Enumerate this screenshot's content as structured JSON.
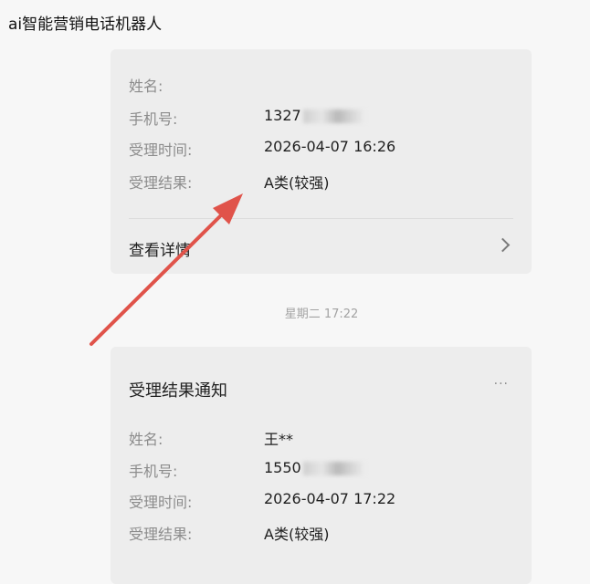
{
  "app": {
    "title": "ai智能营销电话机器人"
  },
  "cards": [
    {
      "rows": [
        {
          "label": "姓名:",
          "value": ""
        },
        {
          "label": "手机号:",
          "value": "1327"
        },
        {
          "label": "受理时间:",
          "value": "2026-04-07 16:26"
        },
        {
          "label": "受理结果:",
          "value": "A类(较强)"
        }
      ],
      "view_detail_label": "查看详情"
    },
    {
      "title": "受理结果通知",
      "more_label": "···",
      "rows": [
        {
          "label": "姓名:",
          "value": "王**"
        },
        {
          "label": "手机号:",
          "value": "1550"
        },
        {
          "label": "受理时间:",
          "value": "2026-04-07 17:22"
        },
        {
          "label": "受理结果:",
          "value": "A类(较强)"
        }
      ]
    }
  ],
  "timestamp": "星期二 17:22",
  "colors": {
    "arrow": "#e0534a",
    "label": "#8c8c8c",
    "card_bg": "#ededed"
  },
  "icons": [
    "chevron-right-icon",
    "more-icon",
    "red-arrow-annotation"
  ]
}
